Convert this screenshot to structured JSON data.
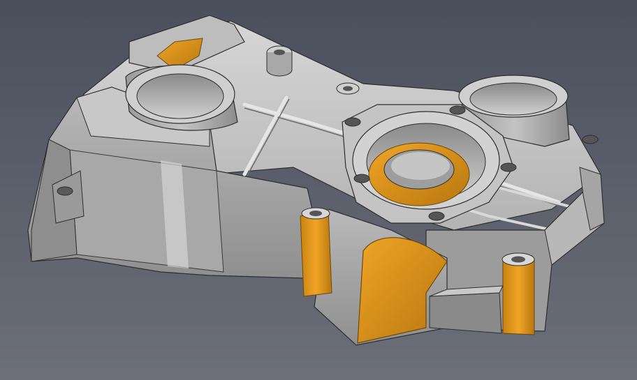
{
  "scene": {
    "subject": "cad-part-timing-cover",
    "colors": {
      "background_top": "#4a4f5c",
      "background_bottom": "#6c6f78",
      "metal_light": "#c9c9c9",
      "metal_mid": "#a9a9a9",
      "metal_dark": "#7e7e7e",
      "edge": "#2e2e2e",
      "highlight_face": "#e39a1e",
      "highlight_face_dark": "#b8770f"
    }
  }
}
